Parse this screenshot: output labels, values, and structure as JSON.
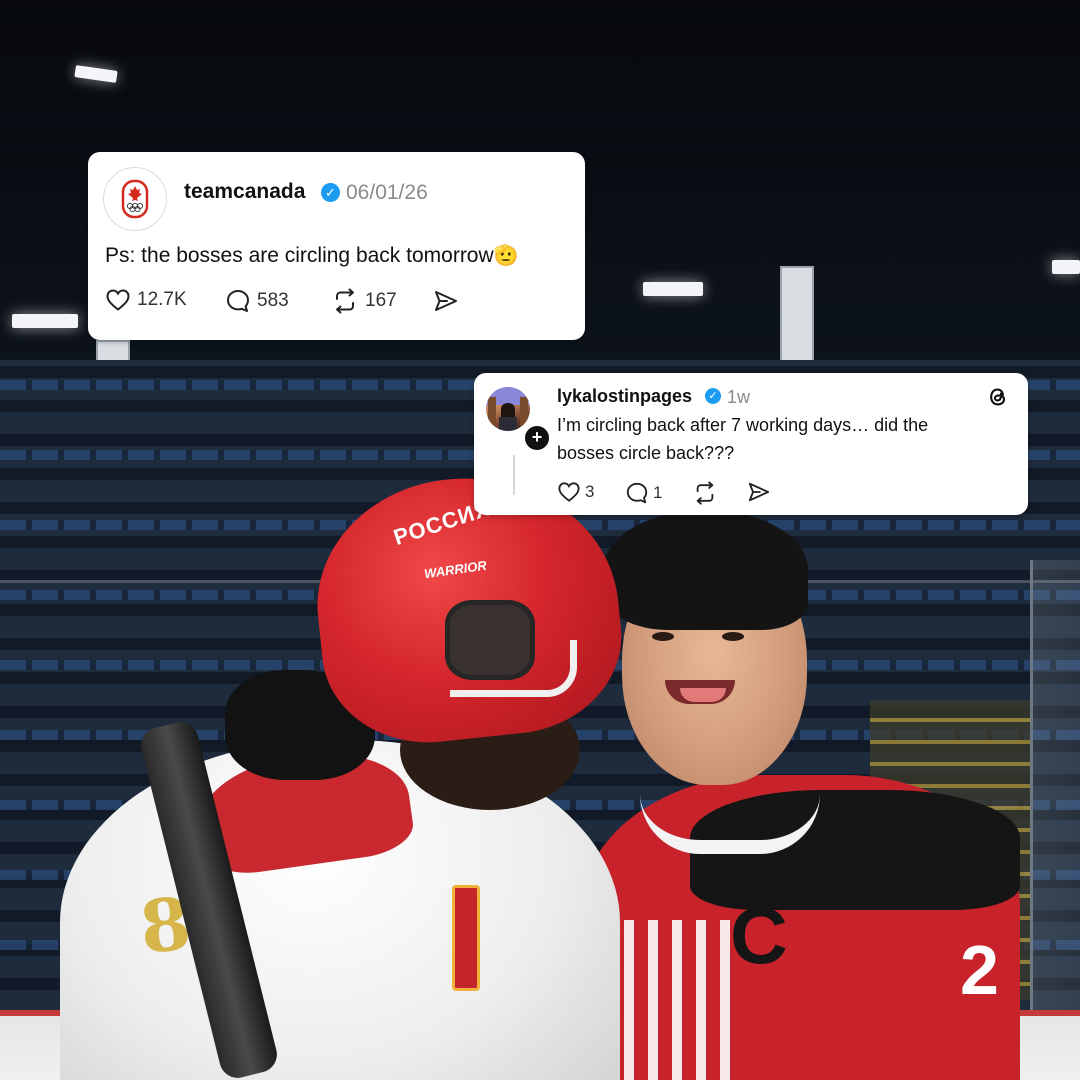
{
  "main_post": {
    "username": "teamcanada",
    "timestamp": "06/01/26",
    "text": "Ps: the bosses are circling back tomorrow",
    "emoji": "🫡",
    "likes": "12.7K",
    "comments": "583",
    "reposts": "167"
  },
  "reply_post": {
    "username": "lykalostinpages",
    "timestamp": "1w",
    "text_line1": "I’m circling back after 7 working days… did the",
    "text_line2": "bosses circle back???",
    "likes": "3",
    "comments": "1",
    "follow_glyph": "+"
  },
  "background": {
    "jersey_left_number": "81",
    "jersey_right_letter": "C",
    "jersey_right_number": "2",
    "helmet_text": "РОССИЯ",
    "helmet_brand": "WARRIOR"
  },
  "icons": {
    "like": "heart-icon",
    "comment": "comment-bubble-icon",
    "repost": "repost-arrows-icon",
    "share": "share-send-icon",
    "verified": "verified-badge-icon",
    "threads": "threads-logo-icon",
    "avatar_main": "canada-olympic-logo"
  },
  "colors": {
    "verified_blue": "#1d9bf0",
    "canada_red": "#d52b1e",
    "card_bg": "#ffffff",
    "muted_text": "#8a8a8a"
  }
}
